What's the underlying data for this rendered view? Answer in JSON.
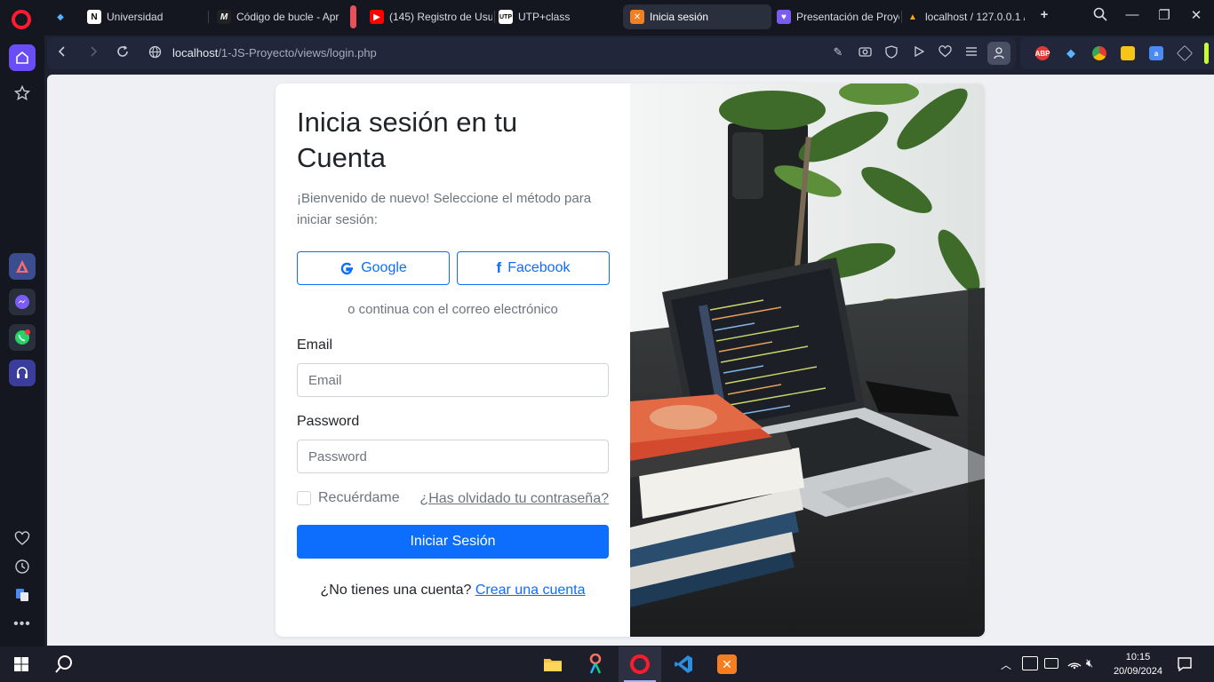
{
  "browser": {
    "tabs": [
      {
        "label": "",
        "favicon": "diamond-icon"
      },
      {
        "label": "Universidad",
        "favicon": "notion-icon"
      },
      {
        "label": "Código de bucle - Apr",
        "favicon": "m-icon"
      },
      {
        "label": "",
        "favicon": "red-tab-icon"
      },
      {
        "label": "(145) Registro de Usu",
        "favicon": "youtube-icon"
      },
      {
        "label": "UTP+class",
        "favicon": "utp-icon"
      },
      {
        "label": "Inicia sesión",
        "favicon": "xampp-icon",
        "active": true
      },
      {
        "label": "Presentación de Proye",
        "favicon": "canva-icon"
      },
      {
        "label": "localhost / 127.0.0.1 /",
        "favicon": "phpmyadmin-icon"
      }
    ],
    "url_host": "localhost",
    "url_path": "/1-JS-Proyecto/views/login.php",
    "extensions": [
      "ABP",
      "gem",
      "chrome",
      "folder",
      "translate",
      "cube"
    ]
  },
  "login": {
    "title_line1": "Inicia sesión en tu",
    "title_line2": "Cuenta",
    "subtitle": "¡Bienvenido de nuevo! Seleccione el método para iniciar sesión:",
    "google_label": "Google",
    "facebook_label": "Facebook",
    "divider": "o continua con el correo electrónico",
    "email_label": "Email",
    "email_placeholder": "Email",
    "password_label": "Password",
    "password_placeholder": "Password",
    "remember_label": "Recuérdame",
    "forgot_label": "¿Has olvidado tu contraseña?",
    "submit_label": "Iniciar Sesión",
    "signup_prompt": "¿No tienes una cuenta?",
    "signup_link": "Crear una cuenta"
  },
  "taskbar": {
    "time": "10:15",
    "date": "20/09/2024"
  },
  "colors": {
    "primary": "#0d6efd",
    "opera_red": "#ff1b2d"
  }
}
